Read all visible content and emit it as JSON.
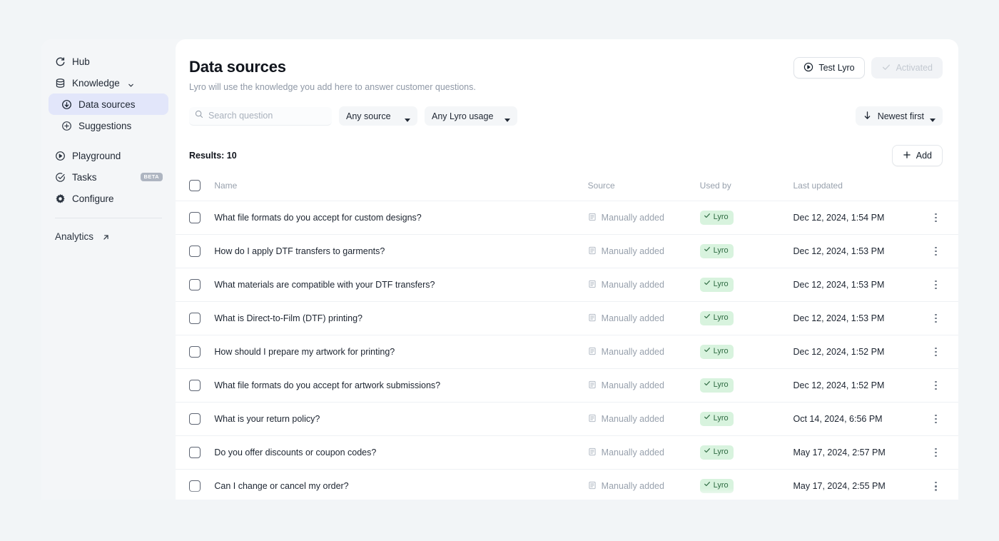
{
  "sidebar": {
    "items": [
      {
        "label": "Hub",
        "icon": "hub-icon",
        "type": "top"
      },
      {
        "label": "Knowledge",
        "icon": "database-icon",
        "type": "group",
        "chevron": "chevron-down-icon"
      },
      {
        "label": "Data sources",
        "icon": "circle-arrow-down-icon",
        "type": "sub",
        "active": true
      },
      {
        "label": "Suggestions",
        "icon": "circle-plus-icon",
        "type": "sub",
        "active": false
      },
      {
        "label": "Playground",
        "icon": "play-circle-icon",
        "type": "top"
      },
      {
        "label": "Tasks",
        "icon": "check-circle-icon",
        "type": "top",
        "badge": "BETA"
      },
      {
        "label": "Configure",
        "icon": "gear-icon",
        "type": "top"
      },
      {
        "label": "Analytics",
        "icon": "external-link-icon",
        "type": "footer"
      }
    ]
  },
  "header": {
    "title": "Data sources",
    "subtitle": "Lyro will use the knowledge you add here to answer customer questions.",
    "test_button": "Test Lyro",
    "activated_button": "Activated"
  },
  "filters": {
    "search_placeholder": "Search question",
    "search_value": "",
    "source_select": "Any source",
    "usage_select": "Any Lyro usage",
    "sort": "Newest first"
  },
  "results": {
    "label": "Results: 10",
    "add_label": "Add"
  },
  "table": {
    "columns": [
      "Name",
      "Source",
      "Used by",
      "Last updated"
    ],
    "rows": [
      {
        "name": "What file formats do you accept for custom designs?",
        "source": "Manually added",
        "used_by": "Lyro",
        "updated": "Dec 12, 2024, 1:54 PM"
      },
      {
        "name": "How do I apply DTF transfers to garments?",
        "source": "Manually added",
        "used_by": "Lyro",
        "updated": "Dec 12, 2024, 1:53 PM"
      },
      {
        "name": "What materials are compatible with your DTF transfers?",
        "source": "Manually added",
        "used_by": "Lyro",
        "updated": "Dec 12, 2024, 1:53 PM"
      },
      {
        "name": "What is Direct-to-Film (DTF) printing?",
        "source": "Manually added",
        "used_by": "Lyro",
        "updated": "Dec 12, 2024, 1:53 PM"
      },
      {
        "name": "How should I prepare my artwork for printing?",
        "source": "Manually added",
        "used_by": "Lyro",
        "updated": "Dec 12, 2024, 1:52 PM"
      },
      {
        "name": "What file formats do you accept for artwork submissions?",
        "source": "Manually added",
        "used_by": "Lyro",
        "updated": "Dec 12, 2024, 1:52 PM"
      },
      {
        "name": "What is your return policy?",
        "source": "Manually added",
        "used_by": "Lyro",
        "updated": "Oct 14, 2024, 6:56 PM"
      },
      {
        "name": "Do you offer discounts or coupon codes?",
        "source": "Manually added",
        "used_by": "Lyro",
        "updated": "May 17, 2024, 2:57 PM"
      },
      {
        "name": "Can I change or cancel my order?",
        "source": "Manually added",
        "used_by": "Lyro",
        "updated": "May 17, 2024, 2:55 PM"
      }
    ]
  },
  "colors": {
    "accent": "#e2e6fa",
    "badge_bg": "#d8f3de",
    "badge_text": "#2f6b43",
    "page_bg": "#f2f5f7"
  }
}
